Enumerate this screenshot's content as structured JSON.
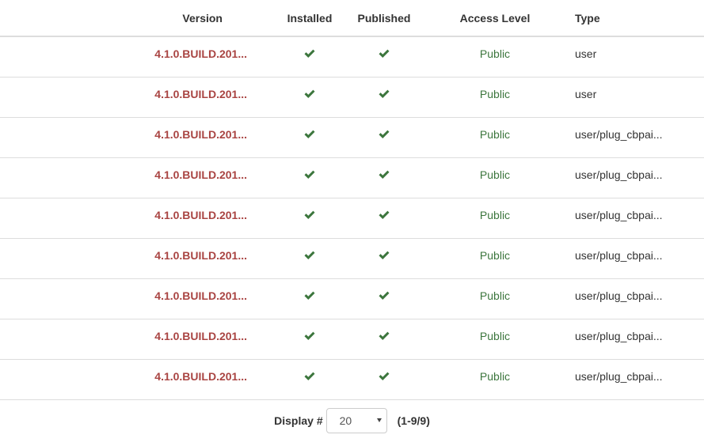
{
  "table": {
    "headers": {
      "version": "Version",
      "installed": "Installed",
      "published": "Published",
      "access_level": "Access Level",
      "type": "Type"
    },
    "rows": [
      {
        "version": "4.1.0.BUILD.201...",
        "installed": true,
        "published": true,
        "access_level": "Public",
        "type": "user"
      },
      {
        "version": "4.1.0.BUILD.201...",
        "installed": true,
        "published": true,
        "access_level": "Public",
        "type": "user"
      },
      {
        "version": "4.1.0.BUILD.201...",
        "installed": true,
        "published": true,
        "access_level": "Public",
        "type": "user/plug_cbpai..."
      },
      {
        "version": "4.1.0.BUILD.201...",
        "installed": true,
        "published": true,
        "access_level": "Public",
        "type": "user/plug_cbpai..."
      },
      {
        "version": "4.1.0.BUILD.201...",
        "installed": true,
        "published": true,
        "access_level": "Public",
        "type": "user/plug_cbpai..."
      },
      {
        "version": "4.1.0.BUILD.201...",
        "installed": true,
        "published": true,
        "access_level": "Public",
        "type": "user/plug_cbpai..."
      },
      {
        "version": "4.1.0.BUILD.201...",
        "installed": true,
        "published": true,
        "access_level": "Public",
        "type": "user/plug_cbpai..."
      },
      {
        "version": "4.1.0.BUILD.201...",
        "installed": true,
        "published": true,
        "access_level": "Public",
        "type": "user/plug_cbpai..."
      },
      {
        "version": "4.1.0.BUILD.201...",
        "installed": true,
        "published": true,
        "access_level": "Public",
        "type": "user/plug_cbpai..."
      }
    ]
  },
  "pagination": {
    "display_label": "Display #",
    "limit_value": "20",
    "range_text": "(1-9/9)"
  },
  "icons": {
    "check": "check-icon"
  },
  "colors": {
    "version_link": "#a94442",
    "check": "#3c763d",
    "access_public": "#3c763d",
    "border": "#dddddd"
  }
}
